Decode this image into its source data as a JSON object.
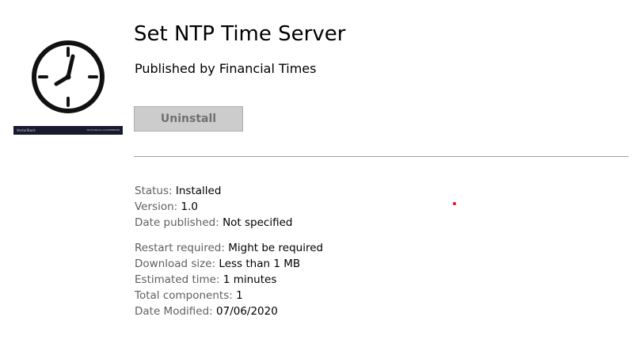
{
  "app": {
    "title": "Set NTP Time Server",
    "publisher": "Published by Financial Times",
    "icon": {
      "name": "clock-icon",
      "watermark_brand": "VectorStock",
      "watermark_id": "VectorStock.com/20588189"
    }
  },
  "actions": {
    "uninstall_label": "Uninstall",
    "uninstall_enabled": false
  },
  "details_group_1": [
    {
      "label": "Status:",
      "value": "Installed"
    },
    {
      "label": "Version:",
      "value": "1.0"
    },
    {
      "label": "Date published:",
      "value": "Not specified"
    }
  ],
  "details_group_2": [
    {
      "label": "Restart required:",
      "value": "Might be required"
    },
    {
      "label": "Download size:",
      "value": "Less than 1 MB"
    },
    {
      "label": "Estimated time:",
      "value": "1 minutes"
    },
    {
      "label": "Total components:",
      "value": "1"
    },
    {
      "label": "Date Modified:",
      "value": "07/06/2020"
    }
  ],
  "colors": {
    "accent_marker": "#e81123"
  }
}
